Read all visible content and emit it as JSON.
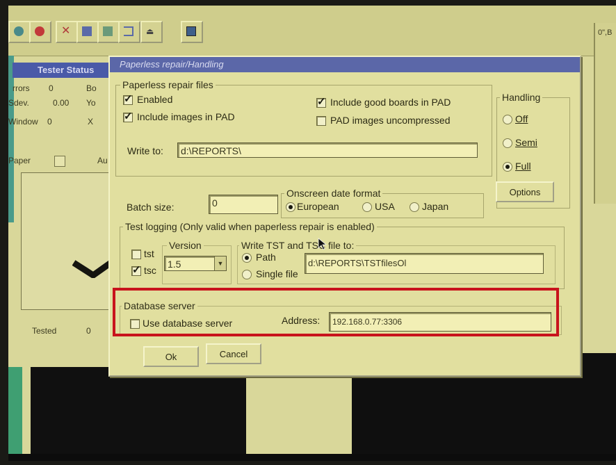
{
  "dialog": {
    "title": "Paperless repair/Handling",
    "repair_files": {
      "group_title": "Paperless repair files",
      "enabled_label": "Enabled",
      "enabled_checked": true,
      "include_images_label": "Include images in PAD",
      "include_images_checked": true,
      "include_good_label": "Include good boards in PAD",
      "include_good_checked": true,
      "pad_uncompressed_label": "PAD images uncompressed",
      "pad_uncompressed_checked": false,
      "write_to_label": "Write to:",
      "write_to_value": "d:\\REPORTS\\"
    },
    "handling": {
      "group_title": "Handling",
      "options": [
        "Off",
        "Semi",
        "Full"
      ],
      "selected": "Full",
      "options_button": "Options"
    },
    "batch": {
      "label": "Batch size:",
      "value": "0"
    },
    "date_format": {
      "group_title": "Onscreen date format",
      "options": [
        "European",
        "USA",
        "Japan"
      ],
      "selected": "European"
    },
    "test_logging": {
      "group_title": "Test logging (Only valid when paperless repair is enabled)",
      "tst_label": "tst",
      "tst_checked": false,
      "tsc_label": "tsc",
      "tsc_checked": true,
      "version_title": "Version",
      "version_value": "1.5",
      "write_title": "Write TST and TSC file to:",
      "path_label": "Path",
      "single_file_label": "Single file",
      "write_selected": "Path",
      "path_value": "d:\\REPORTS\\TSTfilesOl"
    },
    "database": {
      "group_title": "Database server",
      "use_label": "Use database server",
      "use_checked": false,
      "address_label": "Address:",
      "address_value": "192.168.0.77:3306"
    },
    "buttons": {
      "ok": "Ok",
      "cancel": "Cancel"
    }
  },
  "background": {
    "status_title": "Tester Status",
    "errors_label": "rrors",
    "errors_value": "0",
    "sdev_label": "Sdev.",
    "sdev_value": "0.00",
    "window_label": "Window",
    "window_value": "0",
    "paper_label": "Paper",
    "col2_a": "Bo",
    "col2_b": "Yo",
    "col2_c": "X",
    "col2_d": "Au",
    "tested_label": "Tested",
    "tested_value": "0",
    "right_text": "0\",B"
  },
  "colors": {
    "highlight": "#c8131c",
    "title_bar": "#5b67a8",
    "panel": "#e1df9f"
  }
}
